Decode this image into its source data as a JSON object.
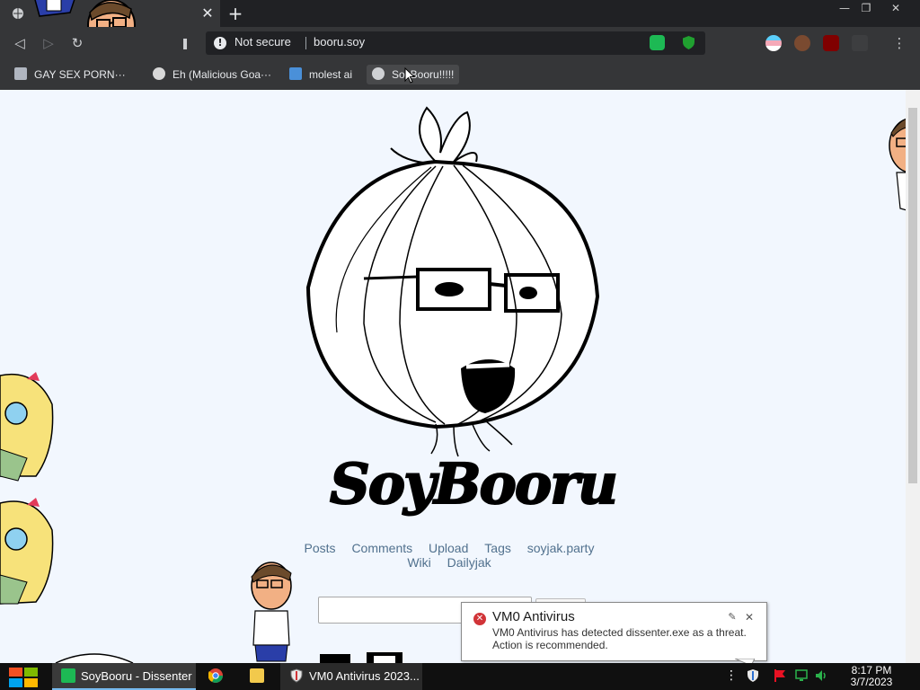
{
  "browser": {
    "tab": {
      "close_label": "✕"
    },
    "new_tab_label": "+",
    "window_controls": {
      "minimize": "—",
      "restore": "❐",
      "close": "✕"
    },
    "nav": {
      "back": "◁",
      "forward": "▷",
      "reload": "↻",
      "bookmark_star": "❚"
    },
    "omnibox": {
      "security_text": "Not secure",
      "url": "booru.soy"
    },
    "menu_label": "⋮"
  },
  "bookmarks": [
    {
      "label": "GAY SEX PORN···"
    },
    {
      "label": "Eh (Malicious Goa···"
    },
    {
      "label": "molest ai"
    },
    {
      "label": "SoyBooru!!!!!"
    }
  ],
  "page": {
    "logo_text": "SoyBooru",
    "nav_links": [
      "Posts",
      "Comments",
      "Upload",
      "Tags",
      "soyjak.party",
      "Wiki",
      "Dailyjak"
    ]
  },
  "notification": {
    "title": "VM0 Antivirus",
    "message": "VM0 Antivirus has detected dissenter.exe as a threat. Action is recommended."
  },
  "taskbar": {
    "tasks": [
      {
        "label": "SoyBooru - Dissenter"
      },
      {
        "label": ""
      },
      {
        "label": ""
      },
      {
        "label": "VM0 Antivirus 2023..."
      }
    ],
    "clock": {
      "time": "8:17 PM",
      "date": "3/7/2023"
    }
  },
  "colors": {
    "tab_bg": "#353638",
    "page_bg": "#f2f7fe",
    "link_color": "#51718e",
    "taskbar_bg": "#101010"
  }
}
